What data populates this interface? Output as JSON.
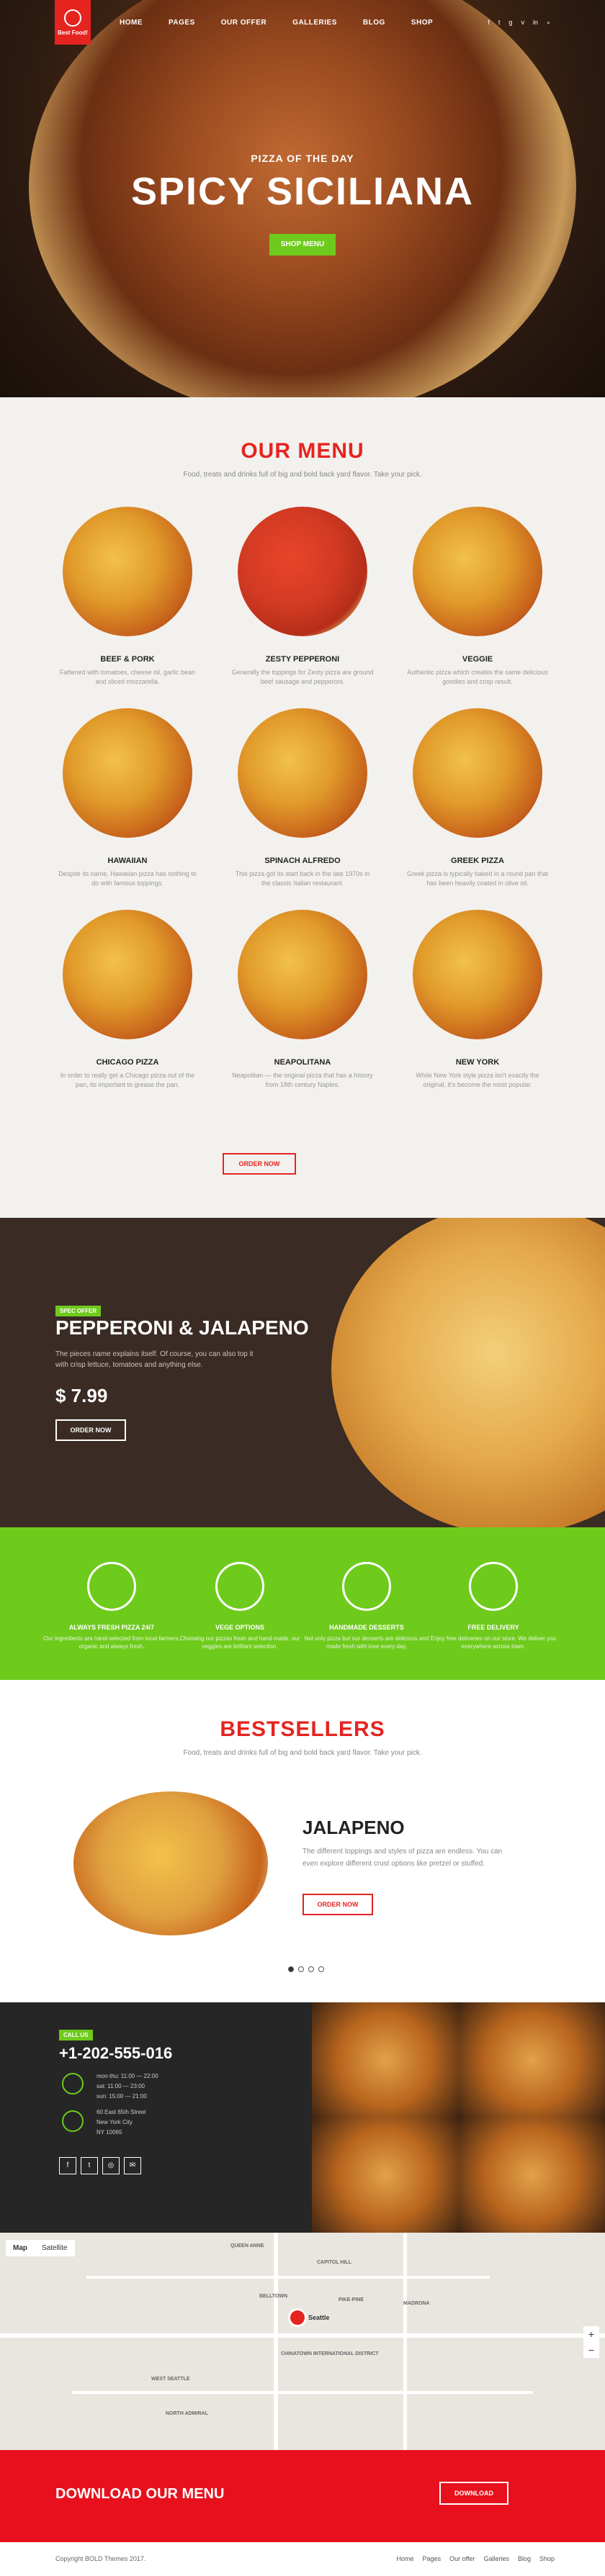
{
  "nav": {
    "logo": "Best Food!",
    "items": [
      "HOME",
      "PAGES",
      "OUR OFFER",
      "GALLERIES",
      "BLOG",
      "SHOP"
    ],
    "social": [
      "f",
      "t",
      "g",
      "v",
      "in",
      "⌕"
    ]
  },
  "hero": {
    "subtitle": "PIZZA OF THE DAY",
    "title": "SPICY SICILIANA",
    "button": "SHOP MENU"
  },
  "our_menu": {
    "title": "OUR MENU",
    "subtitle": "Food, treats and drinks full of big and bold back yard flavor. Take your pick.",
    "items": [
      {
        "name": "BEEF & PORK",
        "desc": "Fattened with tomatoes, cheese oil, garlic bean and sliced mozzarella."
      },
      {
        "name": "ZESTY PEPPERONI",
        "desc": "Generally the toppings for Zesty pizza are ground beef sausage and pepperoni."
      },
      {
        "name": "VEGGIE",
        "desc": "Authentic pizza which creates the same delicious goodies and crisp result."
      },
      {
        "name": "HAWAIIAN",
        "desc": "Despite its name, Hawaiian pizza has nothing to do with famous toppings."
      },
      {
        "name": "SPINACH ALFREDO",
        "desc": "This pizza got its start back in the late 1970s in the classic Italian restaurant."
      },
      {
        "name": "GREEK PIZZA",
        "desc": "Greek pizza is typically baked in a round pan that has been heavily coated in olive oil."
      },
      {
        "name": "CHICAGO PIZZA",
        "desc": "In order to really get a Chicago pizza out of the pan, its important to grease the pan."
      },
      {
        "name": "NEAPOLITANA",
        "desc": "Neapolitan — the original pizza that has a history from 18th century Naples."
      },
      {
        "name": "NEW YORK",
        "desc": "While New York style pizza isn't exactly the original, it's become the most popular."
      }
    ],
    "button": "ORDER NOW"
  },
  "promo": {
    "badge": "SPEC OFFER",
    "title": "PEPPERONI & JALAPENO",
    "desc": "The pieces name explains itself. Of course, you can also top it with crisp lettuce, tomatoes and anything else.",
    "price": "$ 7.99",
    "button": "ORDER NOW"
  },
  "features": [
    {
      "title": "ALWAYS FRESH PIZZA 24/7",
      "desc": "Our ingredients are hand-selected from local farmers, organic and always fresh."
    },
    {
      "title": "VEGE OPTIONS",
      "desc": "Choosing our pizzas fresh and hand-made, our veggies are brilliant selection."
    },
    {
      "title": "HANDMADE DESSERTS",
      "desc": "Not only pizza but our desserts are delicious and made fresh with love every day."
    },
    {
      "title": "FREE DELIVERY",
      "desc": "Enjoy free deliveries on our store. We deliver you everywhere across town."
    }
  ],
  "bestsellers": {
    "title": "BESTSELLERS",
    "subtitle": "Food, treats and drinks full of big and bold back yard flavor. Take your pick.",
    "name": "JALAPENO",
    "desc": "The different toppings and styles of pizza are endless. You can even explore different crust options like pretzel or stuffed.",
    "button": "ORDER NOW"
  },
  "contact": {
    "badge": "CALL US",
    "phone": "+1-202-555-016",
    "hours": [
      "mon-thu: 11:00 — 22:00",
      "sat: 11:00 — 23:00",
      "sun: 15:00 — 21:00"
    ],
    "address": [
      "60 East 65th Street",
      "New York City",
      "NY 10065"
    ],
    "social": [
      "f",
      "t",
      "◎",
      "✉"
    ]
  },
  "map": {
    "tabs": [
      "Map",
      "Satellite"
    ],
    "labels": [
      "QUEEN ANNE",
      "CAPITOL HILL",
      "BELLTOWN",
      "PIKE-PINE",
      "MADRONA",
      "CHINATOWN INTERNATIONAL DISTRICT",
      "WEST SEATTLE",
      "NORTH ADMIRAL"
    ],
    "city": "Seattle"
  },
  "download": {
    "title": "DOWNLOAD OUR MENU",
    "button": "DOWNLOAD"
  },
  "footer": {
    "copyright": "Copyright BOLD Themes 2017.",
    "links": [
      "Home",
      "Pages",
      "Our offer",
      "Galleries",
      "Blog",
      "Shop"
    ]
  }
}
